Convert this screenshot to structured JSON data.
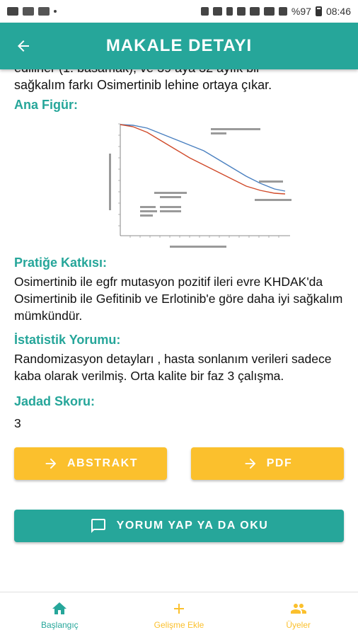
{
  "status_bar": {
    "battery": "%97",
    "time": "08:46"
  },
  "app_bar": {
    "title": "MAKALE DETAYI"
  },
  "content": {
    "cut_line_1": "edilirler (1. basamak), ve 39 aya 32 aylık bir",
    "cut_line_2": "sağkalım farkı Osimertinib lehine ortaya çıkar.",
    "figure_title": "Ana Figür:",
    "practice_title": "Pratiğe Katkısı:",
    "practice_text": "Osimertinib ile egfr mutasyon pozitif ileri evre KHDAK'da Osimertinib ile Gefitinib ve Erlotinib'e göre daha iyi sağkalım mümkündür.",
    "stats_title": "İstatistik Yorumu:",
    "stats_text": "Randomizasyon detayları , hasta sonlanım verileri sadece kaba olarak verilmiş. Orta kalite bir faz 3 çalışma.",
    "jadad_title": "Jadad Skoru:",
    "jadad_value": "3"
  },
  "buttons": {
    "abstract": "ABSTRAKT",
    "pdf": "PDF",
    "comment": "YORUM YAP YA DA OKU"
  },
  "bottom_nav": {
    "home": "Başlangıç",
    "add": "Gelişme Ekle",
    "members": "Üyeler"
  },
  "colors": {
    "primary": "#26a69a",
    "accent": "#fbc02d"
  }
}
